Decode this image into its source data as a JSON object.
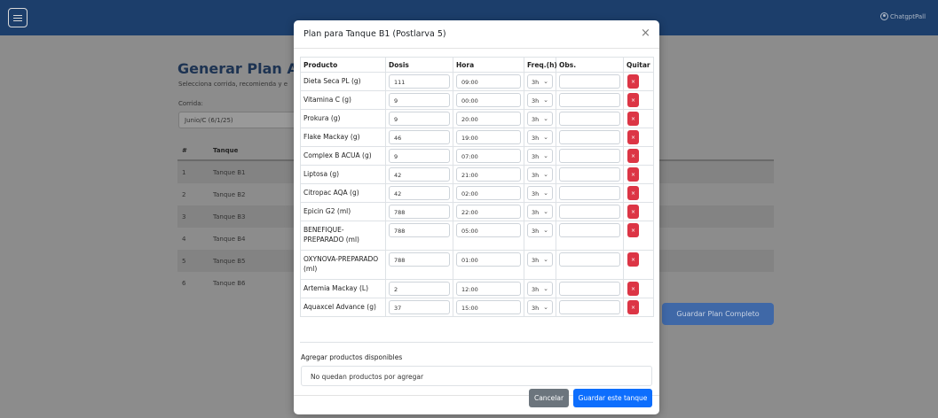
{
  "background": {
    "user_label": "ChatgptPall",
    "title": "Generar Plan Alim",
    "subtitle": "Selecciona corrida, recomienda y e",
    "corrida_label": "Corrida:",
    "corrida_value": "Junio/C (6/1/25)",
    "table_headers": [
      "#",
      "Tanque"
    ],
    "tanks": [
      {
        "num": "1",
        "name": "Tanque B1"
      },
      {
        "num": "2",
        "name": "Tanque B2"
      },
      {
        "num": "3",
        "name": "Tanque B3"
      },
      {
        "num": "4",
        "name": "Tanque B4"
      },
      {
        "num": "5",
        "name": "Tanque B5"
      },
      {
        "num": "6",
        "name": "Tanque B6"
      }
    ],
    "save_all_label": "Guardar Plan Completo"
  },
  "modal": {
    "title": "Plan para Tanque B1 (Postlarva 5)",
    "close_glyph": "×",
    "headers": {
      "producto": "Producto",
      "dosis": "Dosis",
      "hora": "Hora",
      "freq": "Freq.(h)",
      "obs": "Obs.",
      "quitar": "Quitar"
    },
    "rows": [
      {
        "producto": "Dieta Seca PL (g)",
        "dosis": "111",
        "hora": "09:00",
        "freq": "3h",
        "obs": ""
      },
      {
        "producto": "Vitamina C (g)",
        "dosis": "9",
        "hora": "00:00",
        "freq": "3h",
        "obs": ""
      },
      {
        "producto": "Prokura (g)",
        "dosis": "9",
        "hora": "20:00",
        "freq": "3h",
        "obs": ""
      },
      {
        "producto": "Flake Mackay (g)",
        "dosis": "46",
        "hora": "19:00",
        "freq": "3h",
        "obs": ""
      },
      {
        "producto": "Complex B ACUA (g)",
        "dosis": "9",
        "hora": "07:00",
        "freq": "3h",
        "obs": ""
      },
      {
        "producto": "Liptosa (g)",
        "dosis": "42",
        "hora": "21:00",
        "freq": "3h",
        "obs": ""
      },
      {
        "producto": "Citropac AQA (g)",
        "dosis": "42",
        "hora": "02:00",
        "freq": "3h",
        "obs": ""
      },
      {
        "producto": "Epicin G2 (ml)",
        "dosis": "788",
        "hora": "22:00",
        "freq": "3h",
        "obs": ""
      },
      {
        "producto": "BENEFIQUE-PREPARADO (ml)",
        "dosis": "788",
        "hora": "05:00",
        "freq": "3h",
        "obs": ""
      },
      {
        "producto": "OXYNOVA-PREPARADO (ml)",
        "dosis": "788",
        "hora": "01:00",
        "freq": "3h",
        "obs": ""
      },
      {
        "producto": "Artemia Mackay (L)",
        "dosis": "2",
        "hora": "12:00",
        "freq": "3h",
        "obs": ""
      },
      {
        "producto": "Aquaxcel Advance (g)",
        "dosis": "37",
        "hora": "15:00",
        "freq": "3h",
        "obs": ""
      }
    ],
    "delete_glyph": "×",
    "add_section_label": "Agregar productos disponibles",
    "add_empty_text": "No quedan productos por agregar",
    "cancel_label": "Cancelar",
    "save_label": "Guardar este tanque"
  },
  "colors": {
    "topbar": "#1c3e6b",
    "primary": "#0d6efd",
    "danger": "#dc3545",
    "secondary": "#6c757d"
  },
  "icons": [
    "menu-icon",
    "user-icon",
    "close-icon",
    "chevron-down-icon"
  ]
}
